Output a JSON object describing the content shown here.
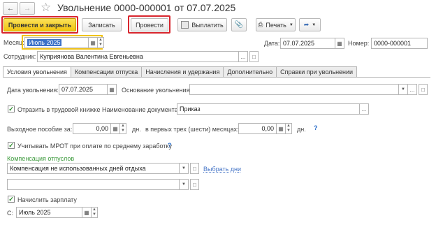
{
  "header": {
    "title": "Увольнение 0000-000001 от 07.07.2025",
    "back_icon": "arrow-left",
    "forward_icon": "arrow-right",
    "star_icon": "star"
  },
  "toolbar": {
    "post_close_label": "Провести и закрыть",
    "save_label": "Записать",
    "post_label": "Провести",
    "pay_label": "Выплатить",
    "print_label": "Печать",
    "highlight_color": "#d8262e",
    "primary_color": "#f2c40e"
  },
  "form": {
    "month_label": "Месяц:",
    "month_value": "Июль 2025",
    "date_label": "Дата:",
    "date_value": "07.07.2025",
    "number_label": "Номер:",
    "number_value": "0000-000001",
    "employee_label": "Сотрудник:",
    "employee_value": "Куприянова Валентина Евгеньевна"
  },
  "tabs": [
    {
      "label": "Условия увольнения",
      "active": true
    },
    {
      "label": "Компенсации отпуска",
      "active": false
    },
    {
      "label": "Начисления и удержания",
      "active": false
    },
    {
      "label": "Дополнительно",
      "active": false
    },
    {
      "label": "Справки при увольнении",
      "active": false
    }
  ],
  "conditions": {
    "dismissal_date_label": "Дата увольнения:",
    "dismissal_date_value": "07.07.2025",
    "reason_label": "Основание увольнения:",
    "reason_value": "",
    "workbook_label": "Отразить в трудовой книжке",
    "workbook_checked": true,
    "doc_name_label": "Наименование документа:",
    "doc_name_value": "Приказ",
    "severance_label": "Выходное пособие за:",
    "severance_days_value": "0,00",
    "days_unit": "дн.",
    "first_months_label": "в первых трех (шести) месяцах:",
    "first_months_value": "0,00",
    "help_mark": "?",
    "mrot_label": "Учитывать МРОТ при оплате по среднему заработку",
    "mrot_checked": true,
    "compensation_heading": "Компенсация отпуслов",
    "compensation_value": "Компенсация не использованных дней отдыха",
    "select_days_link": "Выбрать дни",
    "compensation2_value": "",
    "accrue_salary_label": "Начислить зарплату",
    "accrue_salary_checked": true,
    "from_label": "С:",
    "from_value": "Июль 2025"
  }
}
